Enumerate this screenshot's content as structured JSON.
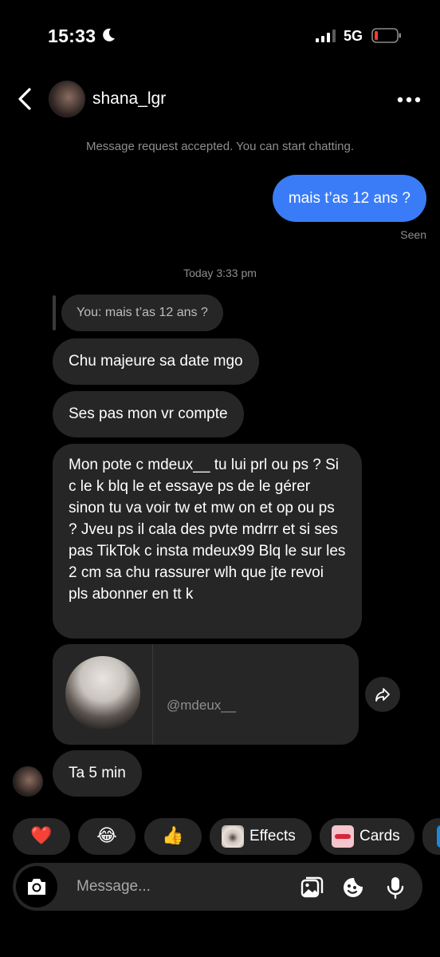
{
  "status_bar": {
    "time": "15:33",
    "network": "5G"
  },
  "header": {
    "username": "shana_lgr"
  },
  "system_note": "Message request accepted. You can start chatting.",
  "outgoing": {
    "text": "mais t’as 12 ans ?",
    "status": "Seen"
  },
  "timestamp": "Today 3:33 pm",
  "reply_quote": "You: mais t’as 12 ans ?",
  "incoming": [
    "Chu majeure sa date mgo",
    "Ses pas mon vr compte",
    "Mon pote c mdeux__ tu lui prl ou ps ? Si c le k blq le et essaye ps de le gérer sinon tu va voir tw et mw on et op ou ps ? Jveu ps il cala des pvte mdrrr et si ses pas TikTok c insta mdeux99 Blq le sur les 2 cm sa chu rassurer wlh que jte revoi pls abonner en tt k",
    "Ta 5 min"
  ],
  "profile_card": {
    "handle": "@mdeux__"
  },
  "quick_replies": {
    "heart": "❤️",
    "laugh": "😂",
    "thumbs": "👍",
    "effects": "Effects",
    "cards": "Cards"
  },
  "composer": {
    "placeholder": "Message..."
  },
  "colors": {
    "outgoing_bubble": "#3a7cf7",
    "incoming_bubble": "#262626",
    "background": "#000000"
  },
  "icons": [
    "moon-icon",
    "signal-icon",
    "battery-icon",
    "back-icon",
    "more-icon",
    "share-icon",
    "camera-icon",
    "gallery-icon",
    "sticker-icon",
    "mic-icon"
  ]
}
